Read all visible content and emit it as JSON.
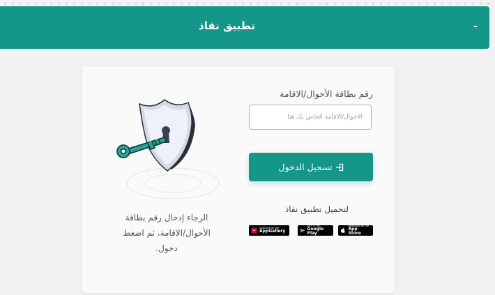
{
  "header": {
    "title": "تطبيق نفاذ",
    "toggle_symbol": "-"
  },
  "form": {
    "id_label": "رقم بطاقة الأحوال/الاقامة",
    "id_placeholder": "الأحوال/الاقامة الخاص بك هنا",
    "id_value": "",
    "login_label": "تسجيل الدخول"
  },
  "download": {
    "label": "لتحميل تطبيق نفاذ",
    "stores": [
      {
        "small": "Download on the",
        "big": "App Store",
        "icon": "apple-icon"
      },
      {
        "small": "GET IT ON",
        "big": "Google Play",
        "icon": "google-play-icon"
      },
      {
        "small": "Available on the",
        "big": "AppGallery",
        "icon": "huawei-icon"
      }
    ]
  },
  "instruction": "الرجاء إدخال رقم بطاقة الأحوال/الاقامة، ثم اضغط دخول.",
  "colors": {
    "brand": "#149789",
    "appgallery_icon": "#c8102e"
  }
}
